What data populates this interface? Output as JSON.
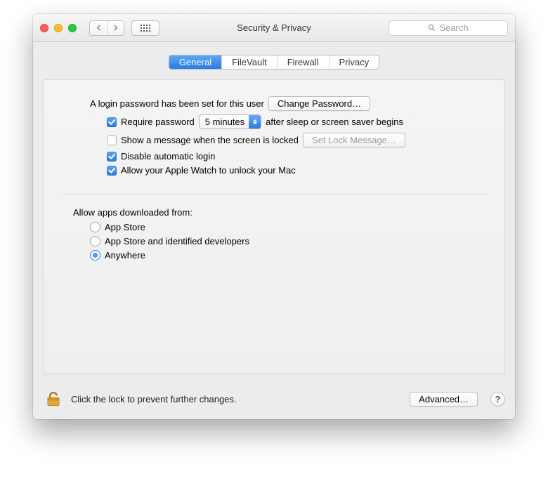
{
  "window": {
    "title": "Security & Privacy"
  },
  "search": {
    "placeholder": "Search"
  },
  "tabs": [
    "General",
    "FileVault",
    "Firewall",
    "Privacy"
  ],
  "active_tab": 0,
  "login": {
    "intro": "A login password has been set for this user",
    "change_btn": "Change Password…",
    "require_label": "Require password",
    "delay_value": "5 minutes",
    "require_tail": "after sleep or screen saver begins",
    "show_message_label": "Show a message when the screen is locked",
    "set_lock_btn": "Set Lock Message…",
    "disable_auto_label": "Disable automatic login",
    "watch_label": "Allow your Apple Watch to unlock your Mac",
    "require_checked": true,
    "show_message_checked": false,
    "disable_auto_checked": true,
    "watch_checked": true
  },
  "download": {
    "title": "Allow apps downloaded from:",
    "options": [
      "App Store",
      "App Store and identified developers",
      "Anywhere"
    ],
    "selected": 2
  },
  "footer": {
    "lock_text": "Click the lock to prevent further changes.",
    "advanced_btn": "Advanced…",
    "help": "?"
  }
}
